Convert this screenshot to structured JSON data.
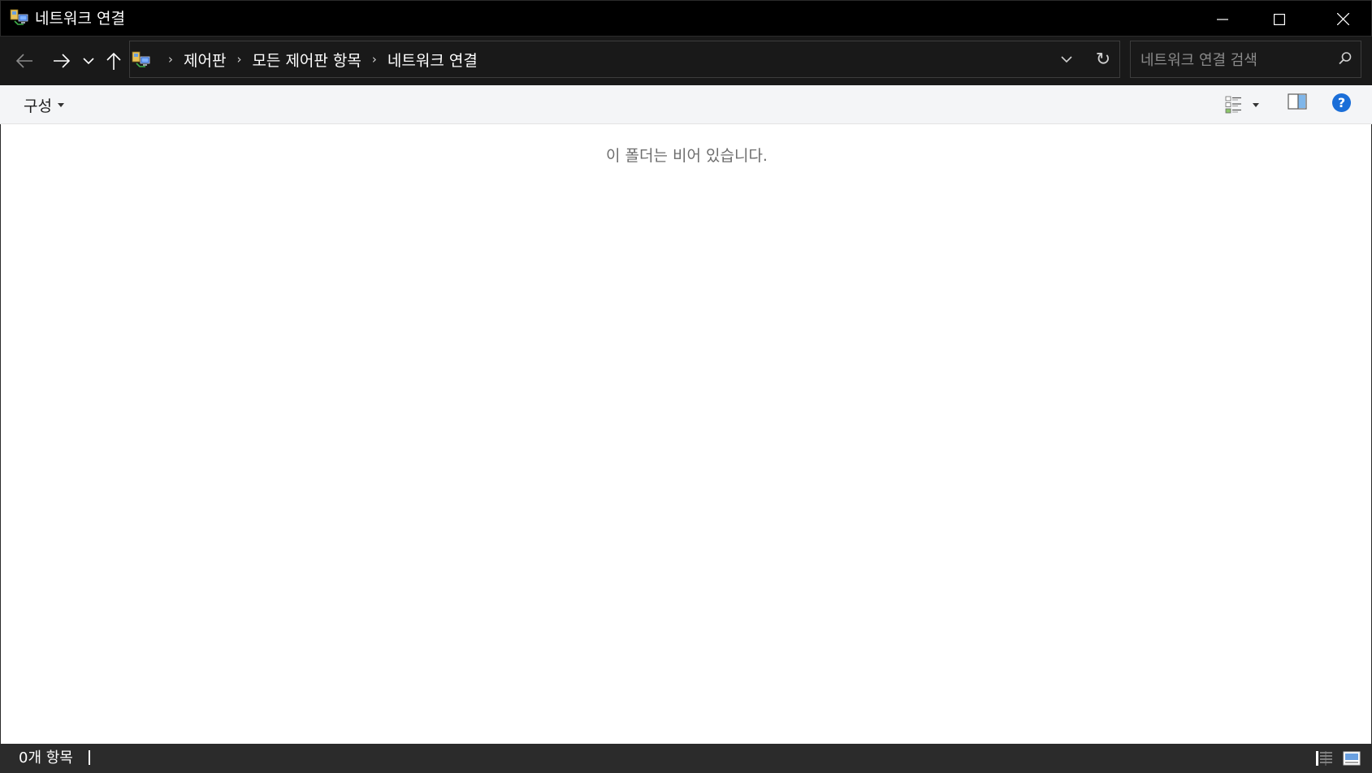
{
  "window": {
    "title": "네트워크 연결",
    "icon": "network-connections-icon",
    "controls": [
      "minimize-icon",
      "maximize-icon",
      "close-icon"
    ]
  },
  "nav": {
    "back_icon": "arrow-left-icon",
    "forward_icon": "arrow-right-icon",
    "recent_icon": "chevron-down-icon",
    "up_icon": "arrow-up-icon"
  },
  "address": {
    "crumbs": [
      "제어판",
      "모든 제어판 항목",
      "네트워크 연결"
    ],
    "refresh_glyph": "↻"
  },
  "search": {
    "placeholder": "네트워크 연결 검색"
  },
  "commandbar": {
    "organize_label": "구성",
    "help_glyph": "?"
  },
  "content": {
    "empty_message": "이 폴더는 비어 있습니다."
  },
  "status": {
    "item_count": "0개 항목"
  },
  "colors": {
    "titlebar": "#000000",
    "addressbar": "#191919",
    "commandbar": "#f4f5f7",
    "statusbar": "#2b2b2b",
    "help_accent": "#1a6ed8"
  }
}
